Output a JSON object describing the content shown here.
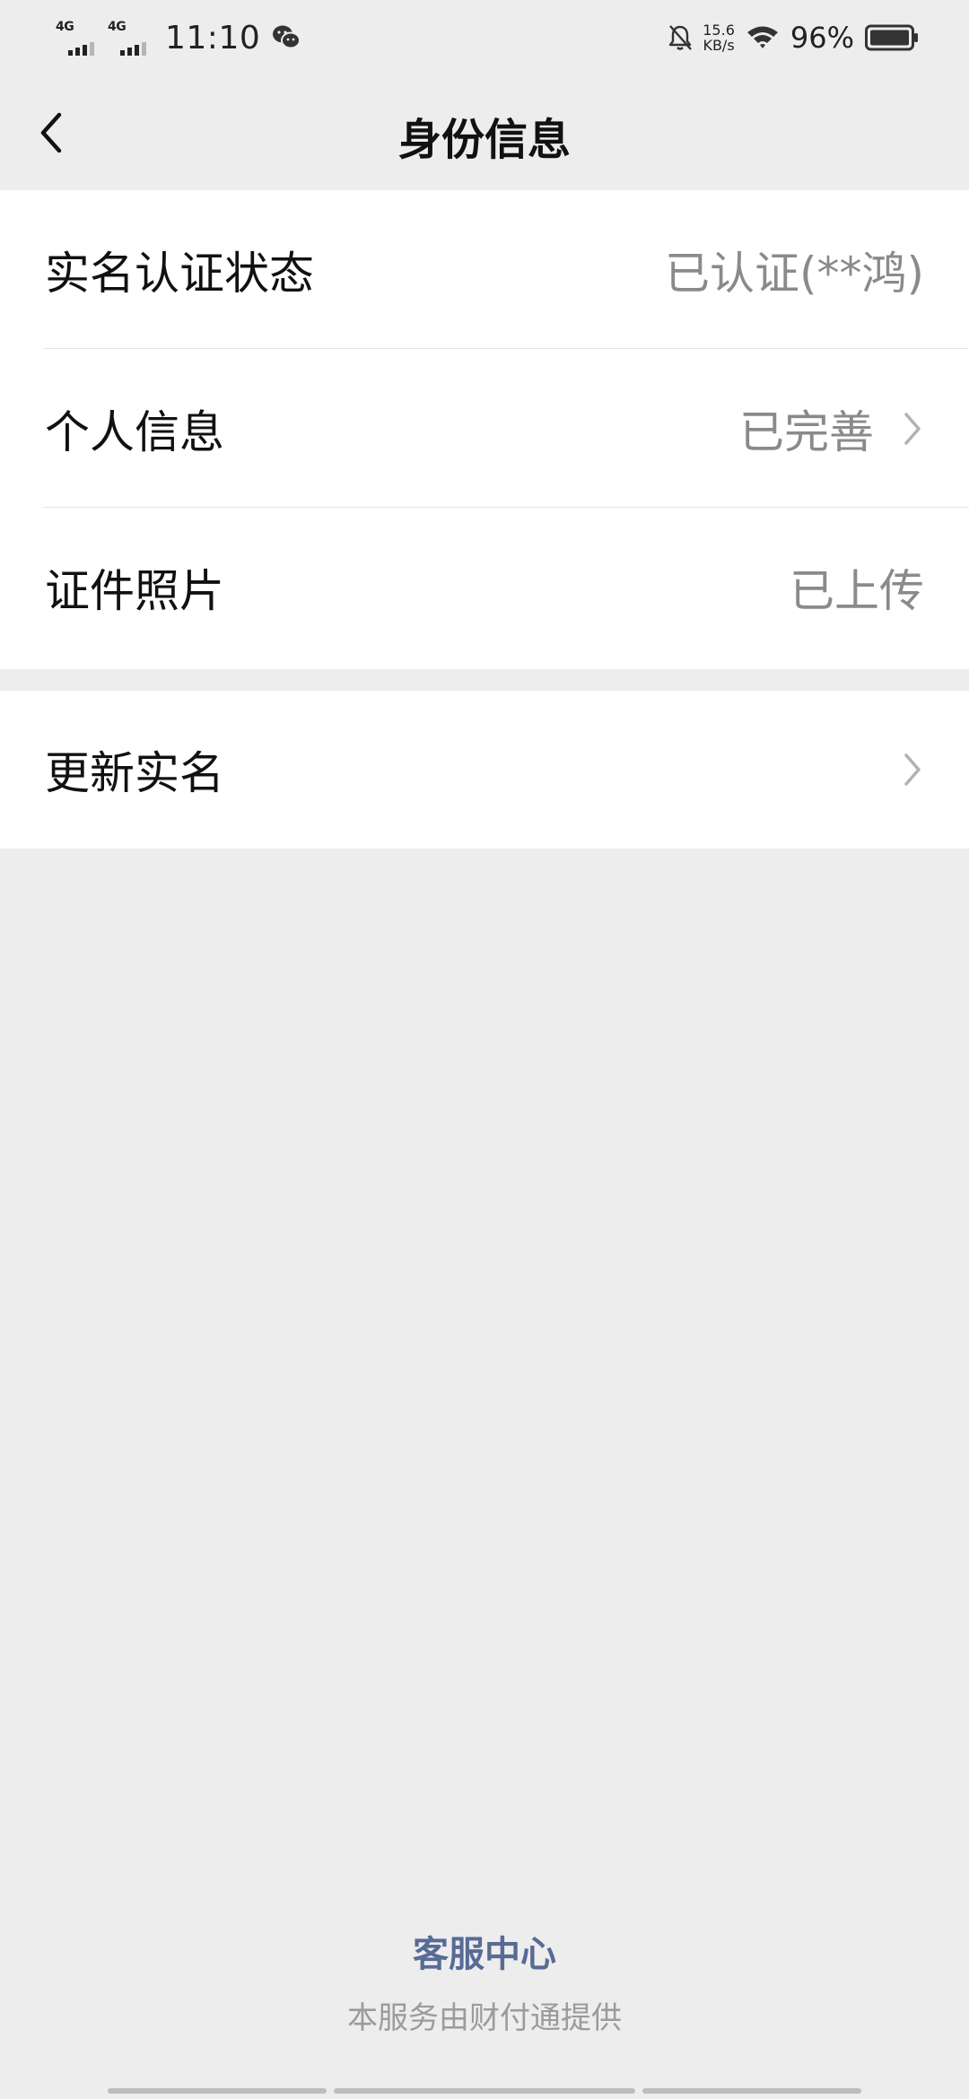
{
  "status_bar": {
    "network_1": "4G",
    "network_2": "4G",
    "time": "11:10",
    "speed_value": "15.6",
    "speed_unit": "KB/s",
    "battery": "96%",
    "icons": [
      "wechat-icon",
      "bell-off-icon",
      "wifi-icon",
      "battery-icon"
    ]
  },
  "nav": {
    "title": "身份信息",
    "back_icon": "chevron-left-icon"
  },
  "rows": [
    {
      "label": "实名认证状态",
      "value": "已认证(**鸿)",
      "arrow": false
    },
    {
      "label": "个人信息",
      "value": "已完善",
      "arrow": true
    },
    {
      "label": "证件照片",
      "value": "已上传",
      "arrow": false
    }
  ],
  "update_row": {
    "label": "更新实名",
    "arrow": true
  },
  "footer": {
    "link": "客服中心",
    "note": "本服务由财付通提供"
  },
  "colors": {
    "background": "#ededed",
    "card": "#ffffff",
    "link": "#576b95",
    "secondary_text": "#8a8a8a"
  }
}
